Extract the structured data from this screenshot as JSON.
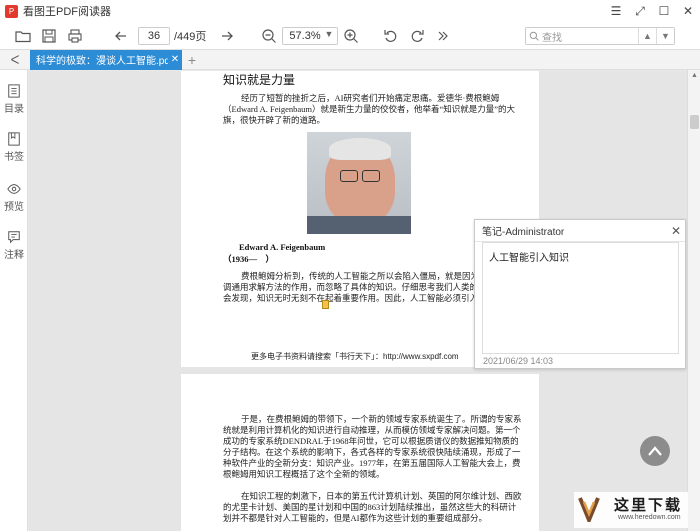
{
  "app": {
    "title": "看图王PDF阅读器",
    "logo_text": "P"
  },
  "window_controls": [
    {
      "name": "menu-icon",
      "glyph": "☰"
    },
    {
      "name": "fullscreen-icon",
      "glyph": "⤢"
    },
    {
      "name": "maximize-icon",
      "glyph": "☐"
    },
    {
      "name": "close-icon",
      "glyph": "✕"
    }
  ],
  "toolbar": {
    "current_page": "36",
    "total_pages": "/449页",
    "zoom": "57.3%"
  },
  "search": {
    "placeholder": "查找"
  },
  "tabs": [
    {
      "label": "科学的极致：漫谈人工智能.pdf",
      "close": "✕"
    }
  ],
  "sidebar": {
    "items": [
      {
        "label": "目录",
        "icon": "toc-icon"
      },
      {
        "label": "书签",
        "icon": "bookmark-icon"
      },
      {
        "label": "预览",
        "icon": "eye-icon"
      },
      {
        "label": "注释",
        "icon": "comment-icon"
      }
    ]
  },
  "document": {
    "page1": {
      "title": "知识就是力量",
      "para1": "经历了短暂的挫折之后，AI研究者们开始痛定思痛。爱德华·费根鲍姆（Edward A. Feigenbaum）就是新生力量的佼佼者，他举着“知识就是力量”的大旗，很快开辟了新的道路。",
      "caption": "Edward A. Feigenbaum",
      "years": "（1936—　）",
      "para2": "费根鲍姆分析到，传统的人工智能之所以会陷入僵局，就是因为他们过于强调通用求解方法的作用，而忽略了具体的知识。仔细思考我们人类的求解过程就会发现，知识无时无刻不在起着重要作用。因此，人工智能必须引入知识。",
      "footer": "更多电子书资料请搜索「书行天下」：http://www.sxpdf.com"
    },
    "page2": {
      "para1": "于是，在费根鲍姆的带领下，一个新的领域专家系统诞生了。所谓的专家系统就是利用计算机化的知识进行自动推理，从而模仿领域专家解决问题。第一个成功的专家系统DENDRAL于1968年问世，它可以根据质谱仪的数据推知物质的分子结构。在这个系统的影响下，各式各样的专家系统很快陆续涌现，形成了一种软件产业的全新分支：知识产业。1977年，在第五届国际人工智能大会上，费根鲍姆用知识工程概括了这个全新的领域。",
      "para2": "在知识工程的刺激下，日本的第五代计算机计划、英国的阿尔维计划、西欧的尤里卡计划、美国的星计划和中国的863计划陆续推出，虽然这些大的科研计划并不都是针对人工智能的，但是AI都作为这些计划的重要组成部分。"
    }
  },
  "note": {
    "title": "笔记-Administrator",
    "content": "人工智能引入知识",
    "date": "2021/06/29 14:03"
  },
  "watermark": {
    "text": "这里下载",
    "url": "www.heredown.com"
  }
}
